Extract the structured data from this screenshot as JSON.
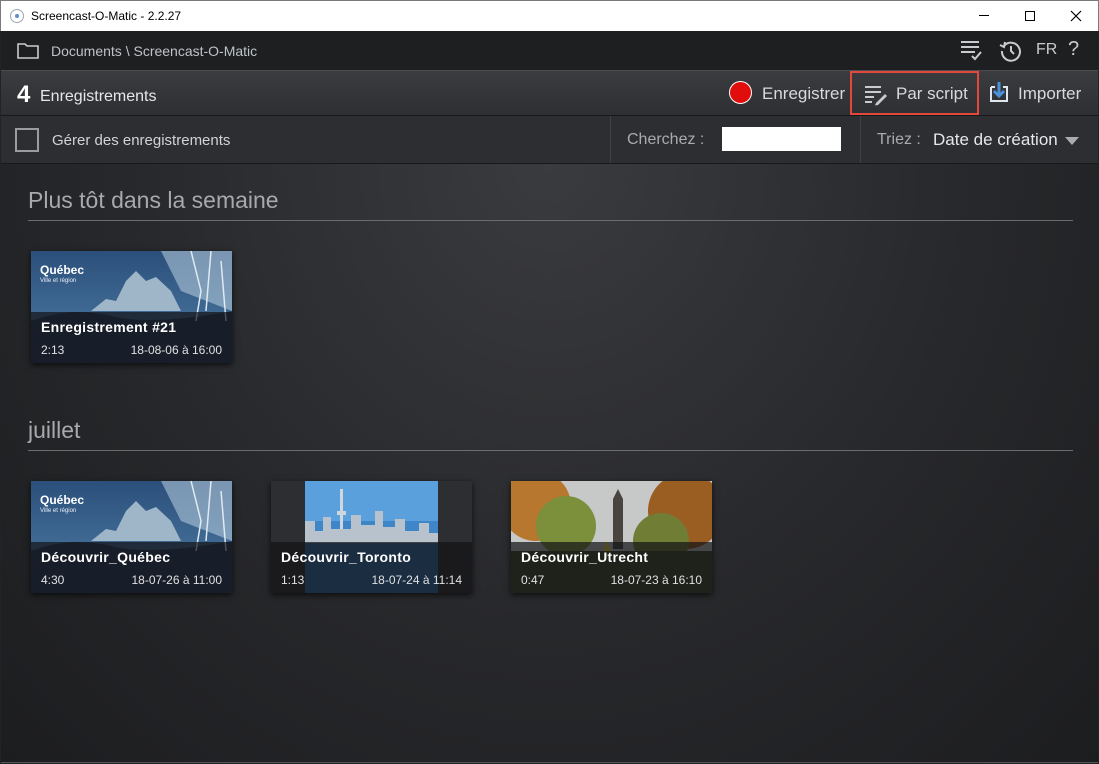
{
  "window": {
    "title": "Screencast-O-Matic - 2.2.27"
  },
  "topbar": {
    "breadcrumb": "Documents \\ Screencast-O-Matic",
    "language": "FR",
    "help": "?"
  },
  "header": {
    "count": "4",
    "count_label": "Enregistrements",
    "record_label": "Enregistrer",
    "script_label": "Par script",
    "import_label": "Importer",
    "colors": {
      "record": "#e10d0d",
      "highlight": "#e2483c",
      "accent": "#4a90d9"
    }
  },
  "toolbar": {
    "manage_label": "Gérer des enregistrements",
    "search_label": "Cherchez :",
    "search_value": "",
    "sort_label": "Triez :",
    "sort_value": "Date de création"
  },
  "sections": [
    {
      "title": "Plus tôt dans la semaine",
      "items": [
        {
          "title": "Enregistrement #21",
          "duration": "2:13",
          "date": "18-08-06 à 16:00",
          "thumb": "quebec",
          "brand": "Québec",
          "brand_sub": "Ville et région"
        }
      ]
    },
    {
      "title": "juillet",
      "items": [
        {
          "title": "Découvrir_Québec",
          "duration": "4:30",
          "date": "18-07-26 à 11:00",
          "thumb": "quebec",
          "brand": "Québec",
          "brand_sub": "Ville et région"
        },
        {
          "title": "Découvrir_Toronto",
          "duration": "1:13",
          "date": "18-07-24 à 11:14",
          "thumb": "toronto"
        },
        {
          "title": "Découvrir_Utrecht",
          "duration": "0:47",
          "date": "18-07-23 à 16:10",
          "thumb": "utrecht"
        }
      ]
    }
  ]
}
